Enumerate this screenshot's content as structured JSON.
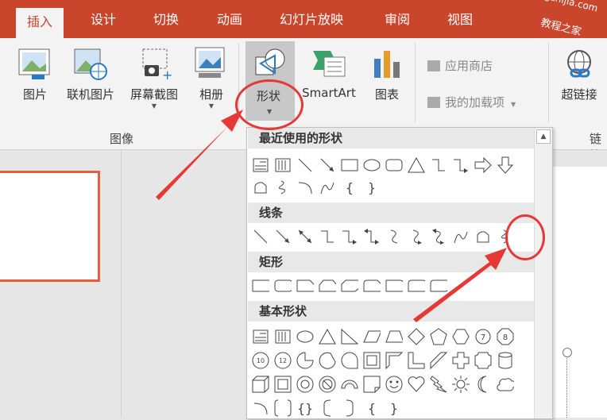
{
  "tabs": [
    {
      "label": "插入",
      "active": true
    },
    {
      "label": "设计"
    },
    {
      "label": "切换"
    },
    {
      "label": "动画"
    },
    {
      "label": "幻灯片放映"
    },
    {
      "label": "审阅"
    },
    {
      "label": "视图"
    }
  ],
  "watermark": {
    "line1": "jiaochengzhijia.com",
    "line2": "教程之家"
  },
  "ribbon": {
    "picture": "图片",
    "online_picture": "联机图片",
    "screenshot": "屏幕截图",
    "album": "相册",
    "shapes": "形状",
    "smartart": "SmartArt",
    "chart": "图表",
    "app_store": "应用商店",
    "my_addins": "我的加载项",
    "hyperlink": "超链接",
    "group_image": "图像",
    "group_links": "链接"
  },
  "dropdown": {
    "recent": "最近使用的形状",
    "lines": "线条",
    "rect": "矩形",
    "basic": "基本形状",
    "recent_row2_symbols": [
      "{",
      "}"
    ],
    "basic_row2_labels": [
      "10",
      "12"
    ],
    "basic_row4_symbols": [
      "{",
      "}",
      "{",
      "}"
    ]
  },
  "colors": {
    "accent": "#c9452b",
    "highlight": "#e53935"
  }
}
